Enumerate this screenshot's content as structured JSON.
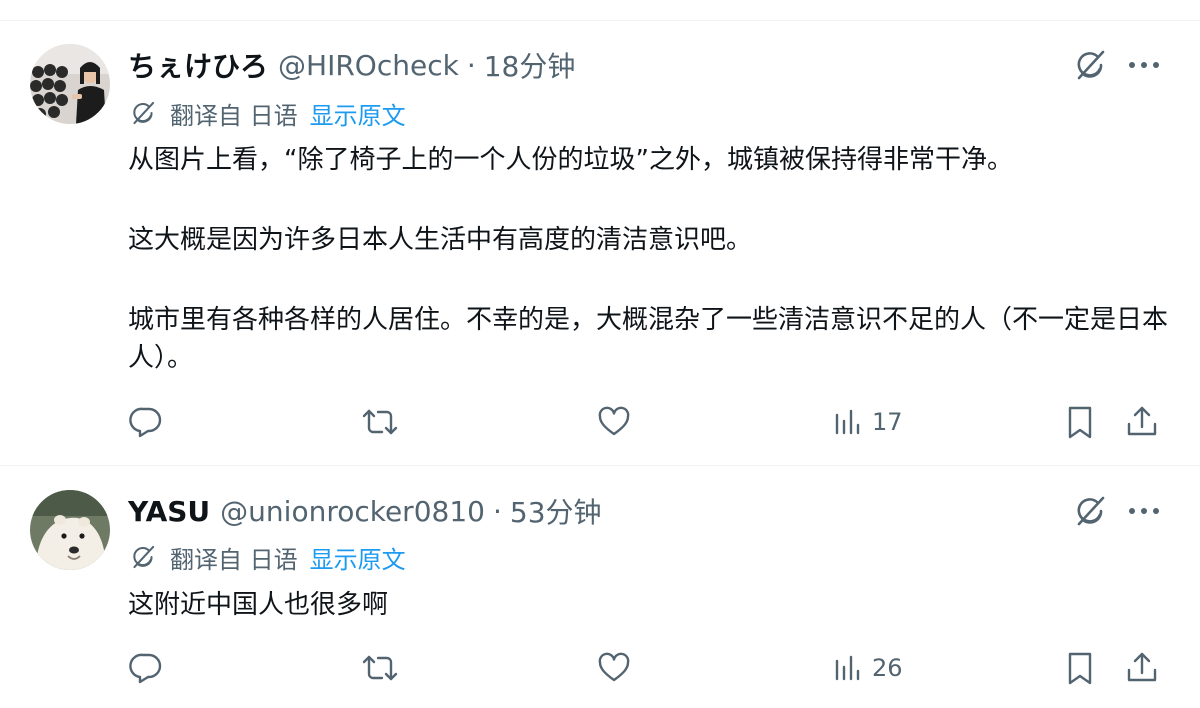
{
  "tweets": [
    {
      "display_name": "ちぇけひろ",
      "handle": "@HIROcheck",
      "separator": "·",
      "time": "18分钟",
      "translation": {
        "label": "翻译自 日语",
        "show_original": "显示原文"
      },
      "paragraphs": [
        "从图片上看，“除了椅子上的一个人份的垃圾”之外，城镇被保持得非常干净。",
        "这大概是因为许多日本人生活中有高度的清洁意识吧。",
        "城市里有各种各样的人居住。不幸的是，大概混杂了一些清洁意识不足的人（不一定是日本人）。"
      ],
      "views": "17"
    },
    {
      "display_name": "YASU",
      "handle": "@unionrocker0810",
      "separator": "·",
      "time": "53分钟",
      "translation": {
        "label": "翻译自 日语",
        "show_original": "显示原文"
      },
      "paragraphs": [
        "这附近中国人也很多啊"
      ],
      "views": "26"
    }
  ],
  "icons": {
    "reply": "reply-icon",
    "retweet": "retweet-icon",
    "like": "heart-icon",
    "views": "views-bar-chart-icon",
    "bookmark": "bookmark-icon",
    "share": "share-icon",
    "grok": "grok-icon",
    "more": "more-dots-icon",
    "translate": "translate-icon"
  },
  "colors": {
    "text_primary": "#0f1419",
    "text_secondary": "#536471",
    "link": "#1d9bf0",
    "divider": "#eff3f4"
  }
}
